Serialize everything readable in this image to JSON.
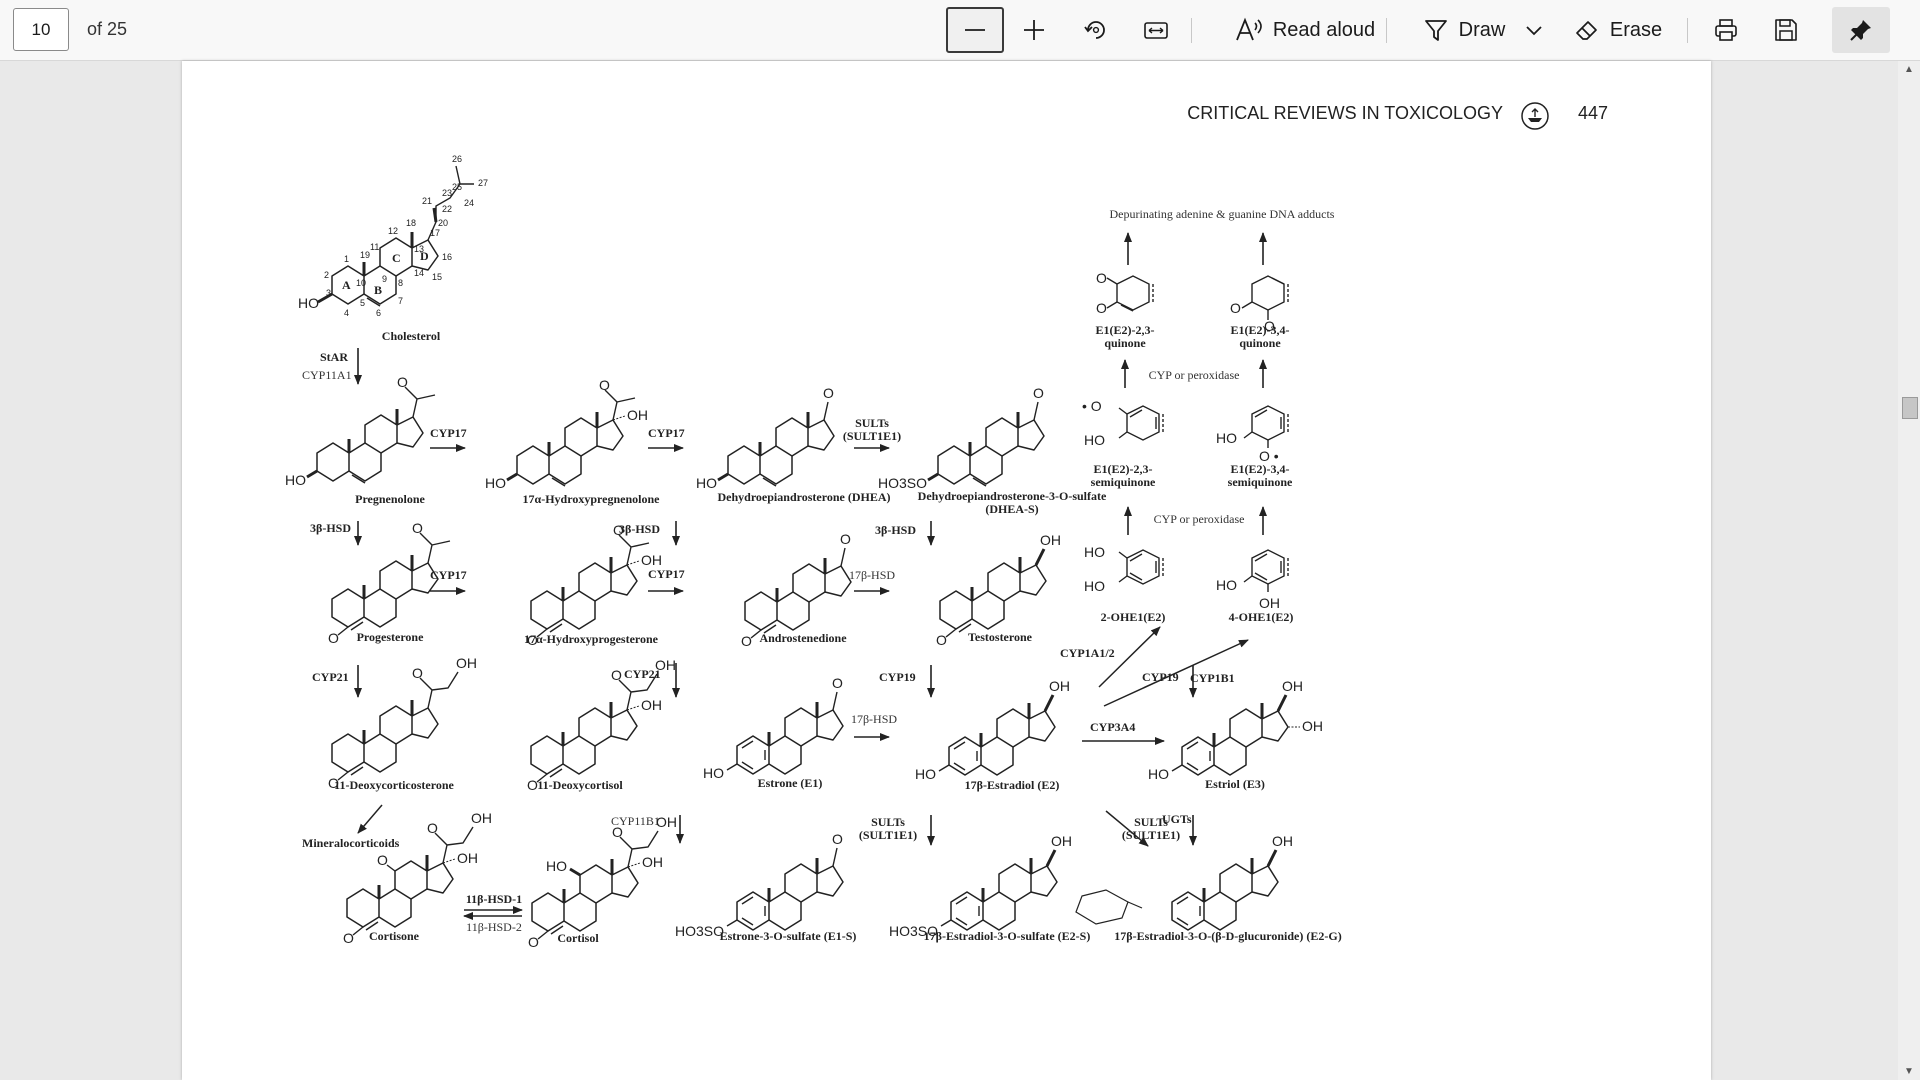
{
  "toolbar": {
    "page_number": "10",
    "page_total": "of 25",
    "read_aloud_label": "Read aloud",
    "draw_label": "Draw",
    "erase_label": "Erase"
  },
  "page": {
    "journal": "CRITICAL REVIEWS IN TOXICOLOGY",
    "page_number": "447"
  },
  "labels": {
    "dna_adducts": "Depurinating adenine & guanine DNA adducts",
    "cyp_perox_1": "CYP or peroxidase",
    "cyp_perox_2": "CYP or peroxidase"
  },
  "compounds": {
    "cholesterol": "Cholesterol",
    "pregnenolone": "Pregnenolone",
    "oh_pregnenolone": "17α-Hydroxypregnenolone",
    "dhea": "Dehydroepiandrosterone (DHEA)",
    "dheas_1": "Dehydroepiandrosterone-3-O-sulfate",
    "dheas_2": "(DHEA-S)",
    "progesterone": "Progesterone",
    "oh_progesterone": "17α-Hydroxyprogesterone",
    "androstenedione": "Androstenedione",
    "testosterone": "Testosterone",
    "doc": "11-Deoxycorticosterone",
    "deoxycortisol": "11-Deoxycortisol",
    "estrone": "Estrone (E1)",
    "estradiol": "17β-Estradiol (E2)",
    "estriol": "Estriol (E3)",
    "mineralocorticoids": "Mineralocorticoids",
    "cortisone": "Cortisone",
    "cortisol": "Cortisol",
    "e1s": "Estrone-3-O-sulfate (E1-S)",
    "e2s": "17β-Estradiol-3-O-sulfate (E2-S)",
    "e2g": "17β-Estradiol-3-O-(β-D-glucuronide) (E2-G)",
    "q23_1": "E1(E2)-2,3-",
    "q23_2": "quinone",
    "q34_1": "E1(E2)-3,4-",
    "q34_2": "quinone",
    "sq23_1": "E1(E2)-2,3-",
    "sq23_2": "semiquinone",
    "sq34_1": "E1(E2)-3,4-",
    "sq34_2": "semiquinone",
    "ohe2": "2-OHE1(E2)",
    "ohe4": "4-OHE1(E2)"
  },
  "enzymes": {
    "star": "StAR",
    "cyp11a1": "CYP11A1",
    "cyp17_a": "CYP17",
    "cyp17_b": "CYP17",
    "cyp17_c": "CYP17",
    "cyp17_d": "CYP17",
    "sults_1": "SULTs",
    "sult1e1_1": "(SULT1E1)",
    "hsd3b_a": "3β-HSD",
    "hsd3b_b": "3β-HSD",
    "hsd3b_c": "3β-HSD",
    "hsd17b_a": "17β-HSD",
    "hsd17b_b": "17β-HSD",
    "cyp21_a": "CYP21",
    "cyp21_b": "CYP21",
    "cyp19_a": "CYP19",
    "cyp19_b": "CYP19",
    "cyp1a12": "CYP1A1/2",
    "cyp1b1": "CYP1B1",
    "cyp3a4": "CYP3A4",
    "cyp11b1": "CYP11B1",
    "hsd11b1": "11β-HSD-1",
    "hsd11b2": "11β-HSD-2",
    "sults_2": "SULTs",
    "sult1e1_2": "(SULT1E1)",
    "sults_3": "SULTs",
    "sult1e1_3": "(SULT1E1)",
    "ugts": "UGTs"
  },
  "atoms": {
    "ho": "HO",
    "o": "O",
    "oh": "OH",
    "ho3so": "HO3SO",
    "o_rad": "• O",
    "o_rad2": "O •"
  },
  "cholesterol_numbers": [
    "1",
    "2",
    "3",
    "4",
    "5",
    "6",
    "7",
    "8",
    "9",
    "10",
    "11",
    "12",
    "13",
    "14",
    "15",
    "16",
    "17",
    "18",
    "19",
    "20",
    "21",
    "22",
    "23",
    "24",
    "25",
    "26",
    "27"
  ],
  "ring_letters": [
    "A",
    "B",
    "C",
    "D"
  ],
  "icons": {
    "zoom_out": "minus-icon",
    "zoom_in": "plus-icon",
    "rotate": "rotate-icon",
    "fit": "fit-width-icon",
    "read_aloud": "read-aloud-icon",
    "draw": "draw-icon",
    "erase": "eraser-icon",
    "print": "print-icon",
    "save": "save-icon",
    "pin": "pin-icon"
  }
}
